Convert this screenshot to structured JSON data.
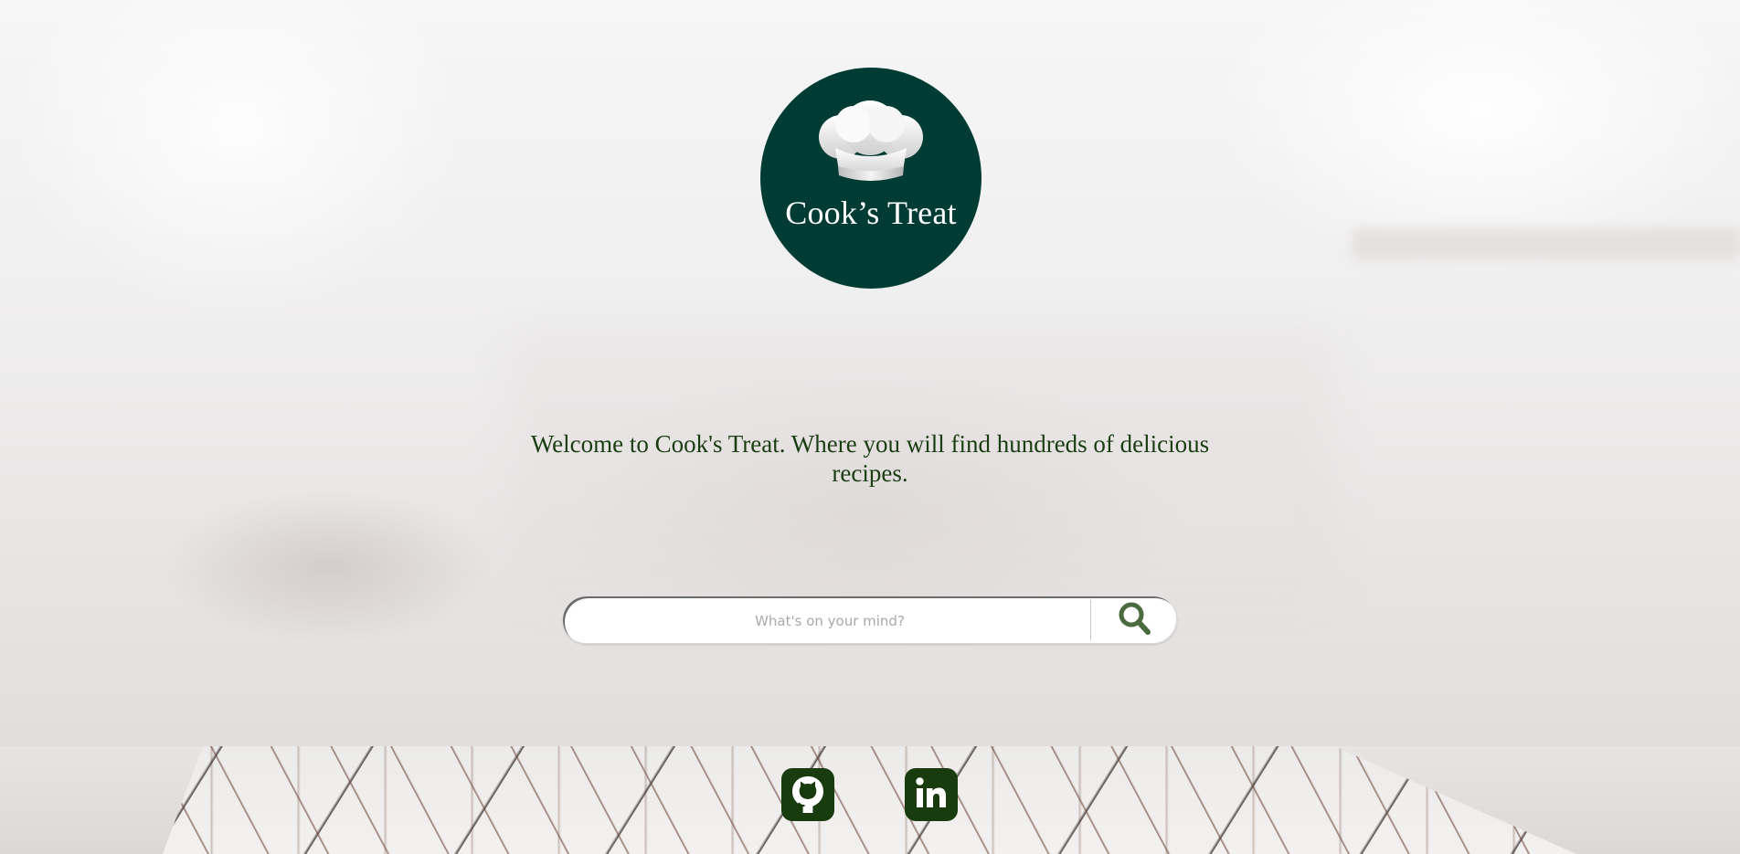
{
  "brand": {
    "name": "Cook’s Treat",
    "logo_icon": "chef-hat-icon",
    "logo_color": "#013c34"
  },
  "welcome": {
    "text": "Welcome to Cook's Treat. Where you will find hundreds of delicious recipes.",
    "color": "#1a3d12"
  },
  "search": {
    "placeholder": "What's on your mind?",
    "value": "",
    "button_icon": "search-icon",
    "icon_color": "#4a6b3e"
  },
  "social": {
    "links": [
      {
        "name": "GitHub",
        "icon": "github-icon"
      },
      {
        "name": "LinkedIn",
        "icon": "linkedin-icon"
      }
    ],
    "color": "#183c0e"
  }
}
